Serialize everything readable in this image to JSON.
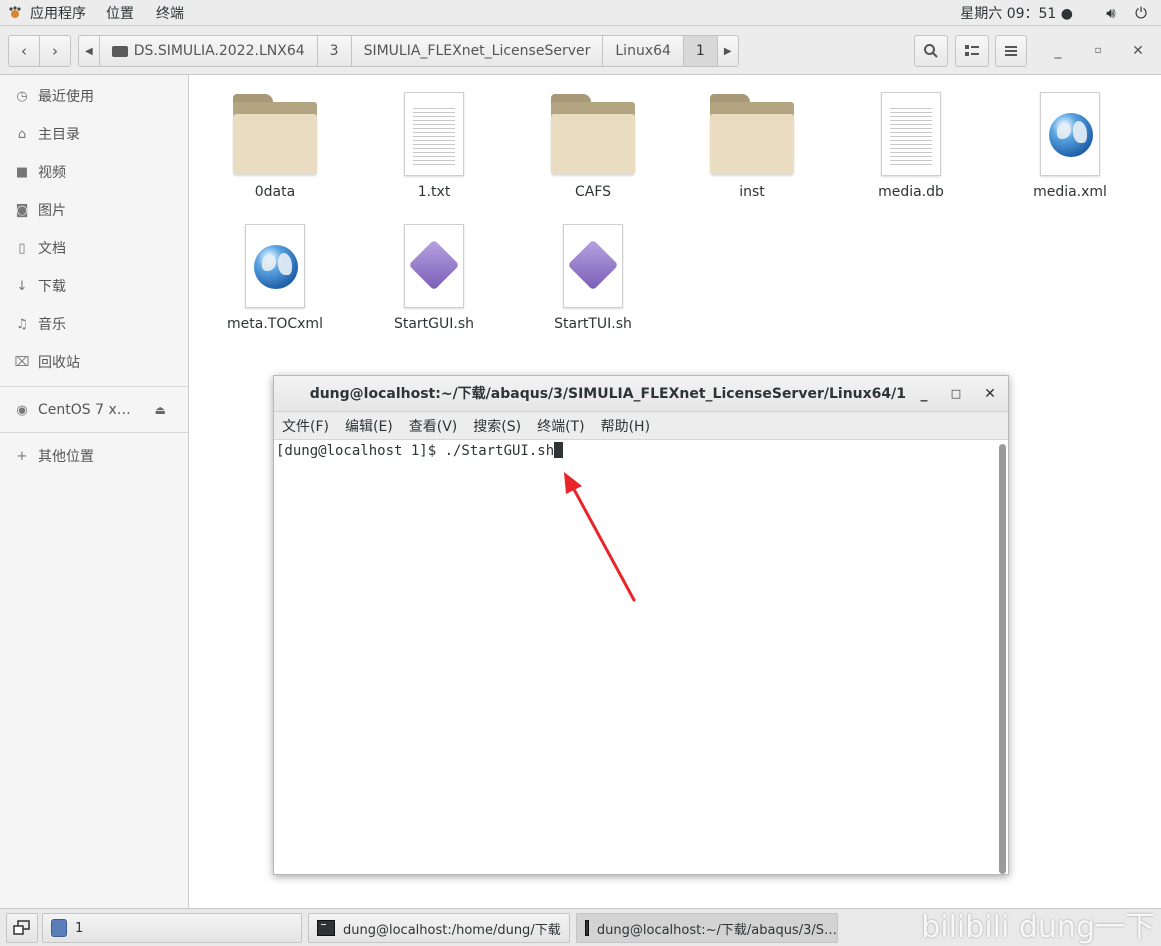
{
  "topbar": {
    "apps": "应用程序",
    "places": "位置",
    "terminal": "终端",
    "clock": "星期六 09：51 ●"
  },
  "header": {
    "path": [
      {
        "label": "DS.SIMULIA.2022.LNX64"
      },
      {
        "label": "3"
      },
      {
        "label": "SIMULIA_FLEXnet_LicenseServer"
      },
      {
        "label": "Linux64"
      },
      {
        "label": "1"
      }
    ]
  },
  "sidebar": {
    "items": [
      {
        "label": "最近使用",
        "icon": "clock-icon"
      },
      {
        "label": "主目录",
        "icon": "home-icon"
      },
      {
        "label": "视频",
        "icon": "video-icon"
      },
      {
        "label": "图片",
        "icon": "camera-icon"
      },
      {
        "label": "文档",
        "icon": "document-icon"
      },
      {
        "label": "下载",
        "icon": "download-icon"
      },
      {
        "label": "音乐",
        "icon": "music-icon"
      },
      {
        "label": "回收站",
        "icon": "trash-icon"
      }
    ],
    "device": "CentOS 7 x…",
    "other": "其他位置"
  },
  "files": [
    {
      "name": "0data",
      "type": "folder"
    },
    {
      "name": "1.txt",
      "type": "text"
    },
    {
      "name": "CAFS",
      "type": "folder"
    },
    {
      "name": "inst",
      "type": "folder"
    },
    {
      "name": "media.db",
      "type": "text"
    },
    {
      "name": "media.xml",
      "type": "web"
    },
    {
      "name": "meta.TOCxml",
      "type": "web"
    },
    {
      "name": "StartGUI.sh",
      "type": "script"
    },
    {
      "name": "StartTUI.sh",
      "type": "script"
    }
  ],
  "terminal": {
    "title": "dung@localhost:~/下载/abaqus/3/SIMULIA_FLEXnet_LicenseServer/Linux64/1",
    "menu": [
      "文件(F)",
      "编辑(E)",
      "查看(V)",
      "搜索(S)",
      "终端(T)",
      "帮助(H)"
    ],
    "prompt": "[dung@localhost 1]$ ",
    "command": "./StartGUI.sh"
  },
  "taskbar": {
    "workspace": "1",
    "tasks": [
      {
        "label": "dung@localhost:/home/dung/下载"
      },
      {
        "label": "dung@localhost:~/下载/abaqus/3/S…"
      }
    ],
    "watermark": "bilibili dung一下"
  },
  "colors": {
    "arrow": "#e8262a",
    "folder": "#e9dcc0",
    "panel": "#ececec"
  }
}
